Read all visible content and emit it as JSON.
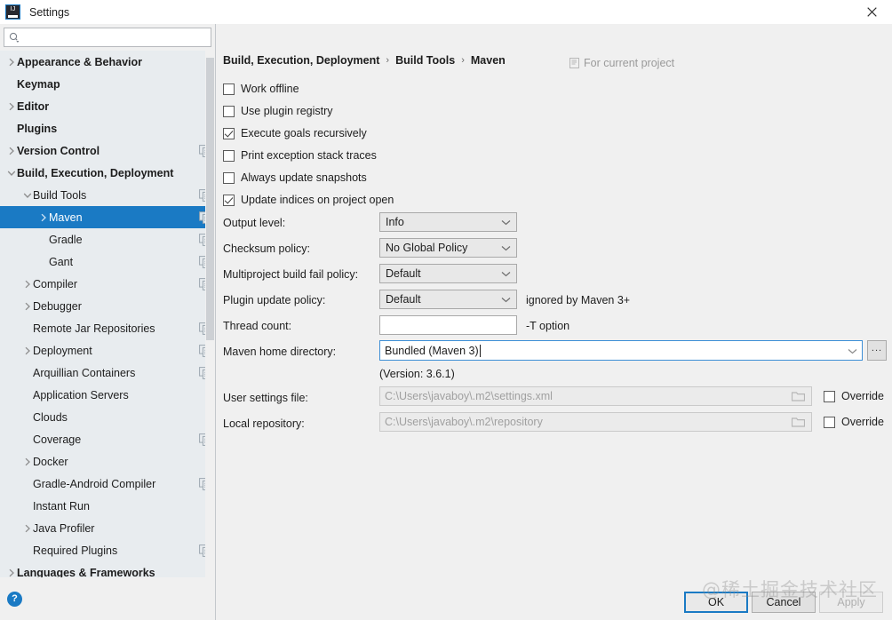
{
  "window": {
    "title": "Settings",
    "logo_text": "IJ",
    "close_icon": "close-icon"
  },
  "search": {
    "placeholder": "",
    "value": "",
    "icon": "search-icon"
  },
  "sidebar": {
    "items": [
      {
        "label": "Appearance & Behavior",
        "indent": 0,
        "arrow": "right",
        "bold": true,
        "config_icon": false,
        "selected": false
      },
      {
        "label": "Keymap",
        "indent": 0,
        "arrow": "none",
        "bold": true,
        "config_icon": false,
        "selected": false
      },
      {
        "label": "Editor",
        "indent": 0,
        "arrow": "right",
        "bold": true,
        "config_icon": false,
        "selected": false
      },
      {
        "label": "Plugins",
        "indent": 0,
        "arrow": "none",
        "bold": true,
        "config_icon": false,
        "selected": false
      },
      {
        "label": "Version Control",
        "indent": 0,
        "arrow": "right",
        "bold": true,
        "config_icon": true,
        "selected": false
      },
      {
        "label": "Build, Execution, Deployment",
        "indent": 0,
        "arrow": "down",
        "bold": true,
        "config_icon": false,
        "selected": false
      },
      {
        "label": "Build Tools",
        "indent": 1,
        "arrow": "down",
        "bold": false,
        "config_icon": true,
        "selected": false
      },
      {
        "label": "Maven",
        "indent": 2,
        "arrow": "right",
        "bold": false,
        "config_icon": true,
        "selected": true
      },
      {
        "label": "Gradle",
        "indent": 2,
        "arrow": "none",
        "bold": false,
        "config_icon": true,
        "selected": false
      },
      {
        "label": "Gant",
        "indent": 2,
        "arrow": "none",
        "bold": false,
        "config_icon": true,
        "selected": false
      },
      {
        "label": "Compiler",
        "indent": 1,
        "arrow": "right",
        "bold": false,
        "config_icon": true,
        "selected": false
      },
      {
        "label": "Debugger",
        "indent": 1,
        "arrow": "right",
        "bold": false,
        "config_icon": false,
        "selected": false
      },
      {
        "label": "Remote Jar Repositories",
        "indent": 1,
        "arrow": "none",
        "bold": false,
        "config_icon": true,
        "selected": false
      },
      {
        "label": "Deployment",
        "indent": 1,
        "arrow": "right",
        "bold": false,
        "config_icon": true,
        "selected": false
      },
      {
        "label": "Arquillian Containers",
        "indent": 1,
        "arrow": "none",
        "bold": false,
        "config_icon": true,
        "selected": false
      },
      {
        "label": "Application Servers",
        "indent": 1,
        "arrow": "none",
        "bold": false,
        "config_icon": false,
        "selected": false
      },
      {
        "label": "Clouds",
        "indent": 1,
        "arrow": "none",
        "bold": false,
        "config_icon": false,
        "selected": false
      },
      {
        "label": "Coverage",
        "indent": 1,
        "arrow": "none",
        "bold": false,
        "config_icon": true,
        "selected": false
      },
      {
        "label": "Docker",
        "indent": 1,
        "arrow": "right",
        "bold": false,
        "config_icon": false,
        "selected": false
      },
      {
        "label": "Gradle-Android Compiler",
        "indent": 1,
        "arrow": "none",
        "bold": false,
        "config_icon": true,
        "selected": false
      },
      {
        "label": "Instant Run",
        "indent": 1,
        "arrow": "none",
        "bold": false,
        "config_icon": false,
        "selected": false
      },
      {
        "label": "Java Profiler",
        "indent": 1,
        "arrow": "right",
        "bold": false,
        "config_icon": false,
        "selected": false
      },
      {
        "label": "Required Plugins",
        "indent": 1,
        "arrow": "none",
        "bold": false,
        "config_icon": true,
        "selected": false
      },
      {
        "label": "Languages & Frameworks",
        "indent": 0,
        "arrow": "right",
        "bold": true,
        "config_icon": false,
        "selected": false
      }
    ],
    "help_label": "?"
  },
  "main": {
    "breadcrumb": [
      "Build, Execution, Deployment",
      "Build Tools",
      "Maven"
    ],
    "breadcrumb_separator": "›",
    "for_current_project": "For current project",
    "checkboxes": [
      {
        "label": "Work offline",
        "checked": false
      },
      {
        "label": "Use plugin registry",
        "checked": false
      },
      {
        "label": "Execute goals recursively",
        "checked": true
      },
      {
        "label": "Print exception stack traces",
        "checked": false
      },
      {
        "label": "Always update snapshots",
        "checked": false
      },
      {
        "label": "Update indices on project open",
        "checked": true
      }
    ],
    "fields": {
      "output_level": {
        "label": "Output level:",
        "value": "Info",
        "hint": ""
      },
      "checksum_policy": {
        "label": "Checksum policy:",
        "value": "No Global Policy",
        "hint": ""
      },
      "multiproject": {
        "label": "Multiproject build fail policy:",
        "value": "Default",
        "hint": ""
      },
      "plugin_update": {
        "label": "Plugin update policy:",
        "value": "Default",
        "hint": "ignored by Maven 3+"
      },
      "thread_count": {
        "label": "Thread count:",
        "value": "",
        "hint": "-T option"
      },
      "maven_home": {
        "label": "Maven home directory:",
        "value": "Bundled (Maven 3)",
        "browse_label": "..."
      },
      "version_note": "(Version: 3.6.1)",
      "user_settings": {
        "label": "User settings file:",
        "value": "C:\\Users\\javaboy\\.m2\\settings.xml",
        "override_label": "Override",
        "override_checked": false
      },
      "local_repository": {
        "label": "Local repository:",
        "value": "C:\\Users\\javaboy\\.m2\\repository",
        "override_label": "Override",
        "override_checked": false
      }
    }
  },
  "buttons": {
    "ok": "OK",
    "cancel": "Cancel",
    "apply": "Apply"
  },
  "watermark": "@稀土掘金技术社区",
  "colors": {
    "accent": "#1a7ac4",
    "sidebar_bg": "#e8ecef",
    "panel_bg": "#f0f0f0"
  }
}
